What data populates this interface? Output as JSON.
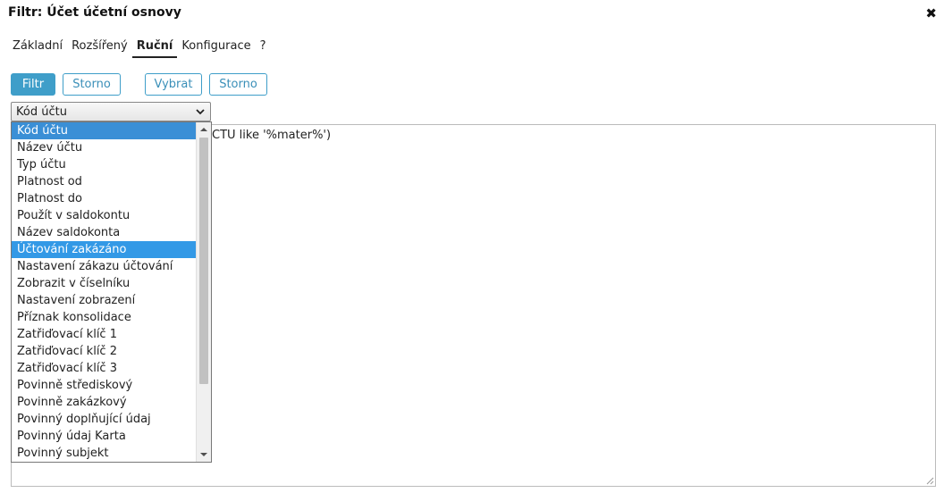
{
  "window": {
    "title": "Filtr: Účet účetní osnovy",
    "close_glyph": "✖"
  },
  "tabs": [
    {
      "label": "Základní"
    },
    {
      "label": "Rozšířený"
    },
    {
      "label": "Ruční",
      "active": true
    },
    {
      "label": "Konfigurace"
    },
    {
      "label": "?"
    }
  ],
  "toolbar": {
    "filter_label": "Filtr",
    "cancel_label_1": "Storno",
    "select_label": "Vybrat",
    "cancel_label_2": "Storno"
  },
  "field_select": {
    "value": "Kód účtu",
    "icon": "chevron-down-icon"
  },
  "editor": {
    "text": "CTU like '%mater%')"
  },
  "dropdown": {
    "options": [
      "Kód účtu",
      "Název účtu",
      "Typ účtu",
      "Platnost od",
      "Platnost do",
      "Použít v saldokontu",
      "Název saldokonta",
      "Účtování zakázáno",
      "Nastavení zákazu účtování",
      "Zobrazit v číselníku",
      "Nastavení zobrazení",
      "Příznak konsolidace",
      "Zatřiďovací klíč 1",
      "Zatřiďovací klíč 2",
      "Zatřiďovací klíč 3",
      "Povinně střediskový",
      "Povinně zakázkový",
      "Povinný doplňující údaj",
      "Povinný údaj Karta",
      "Povinný subjekt"
    ],
    "selected_index": 0,
    "hover_index": 7
  },
  "colors": {
    "accent": "#3f9ec9",
    "selection": "#3399e6"
  }
}
